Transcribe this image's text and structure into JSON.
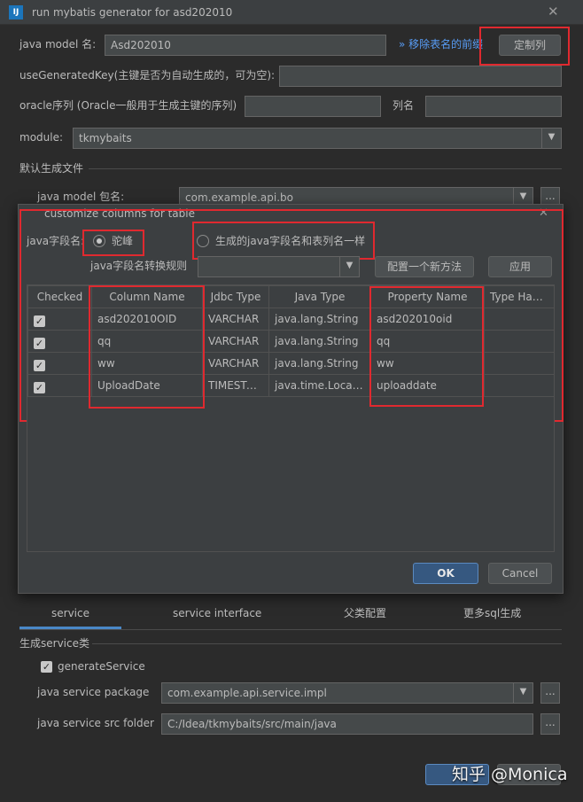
{
  "window": {
    "title": "run mybatis generator for asd202010",
    "close_glyph": "✕"
  },
  "main": {
    "model_name_label": "java model 名:",
    "model_name_value": "Asd202010",
    "remove_prefix_link": "» 移除表名的前缀",
    "custom_columns_button": "定制列",
    "use_generated_key_label": "useGeneratedKey(主键是否为自动生成的，可为空):",
    "oracle_seq_label": "oracle序列 (Oracle一般用于生成主键的序列)",
    "column_name_label": "列名",
    "module_label": "module:",
    "module_value": "tkmybaits",
    "default_files_section": "默认生成文件",
    "java_model_package_label": "java model 包名:",
    "java_model_package_value": "com.example.api.bo"
  },
  "dialog": {
    "title": "customize columns for table",
    "field_name_label": "java字段名:",
    "radio_camel_label": "驼峰",
    "radio_same_label": "生成的java字段名和表列名一样",
    "rule_label": "java字段名转换规则",
    "rule_value": "",
    "config_method_button": "配置一个新方法",
    "apply_button": "应用",
    "table": {
      "headers": [
        "Checked",
        "Column Name",
        "Jdbc Type",
        "Java Type",
        "Property Name",
        "Type Handl..."
      ],
      "rows": [
        {
          "checked": true,
          "column": "asd202010OID",
          "jdbc": "VARCHAR",
          "java": "java.lang.String",
          "property": "asd202010oid",
          "handler": ""
        },
        {
          "checked": true,
          "column": "qq",
          "jdbc": "VARCHAR",
          "java": "java.lang.String",
          "property": "qq",
          "handler": ""
        },
        {
          "checked": true,
          "column": "ww",
          "jdbc": "VARCHAR",
          "java": "java.lang.String",
          "property": "ww",
          "handler": ""
        },
        {
          "checked": true,
          "column": "UploadDate",
          "jdbc": "TIMESTA...",
          "java": "java.time.LocalDat...",
          "property": "uploaddate",
          "handler": ""
        }
      ]
    },
    "ok_button": "OK",
    "cancel_button": "Cancel"
  },
  "tabs": [
    "service",
    "service interface",
    "父类配置",
    "更多sql生成"
  ],
  "service": {
    "section": "生成service类",
    "generate_label": "generateService",
    "package_label": "java service package",
    "package_value": "com.example.api.service.impl",
    "src_label": "java service src folder",
    "src_value": "C:/Idea/tkmybaits/src/main/java"
  },
  "watermark": "知乎 @Monica",
  "colors": {
    "accent": "#365880",
    "highlight": "#e0292f",
    "link": "#589df6"
  }
}
